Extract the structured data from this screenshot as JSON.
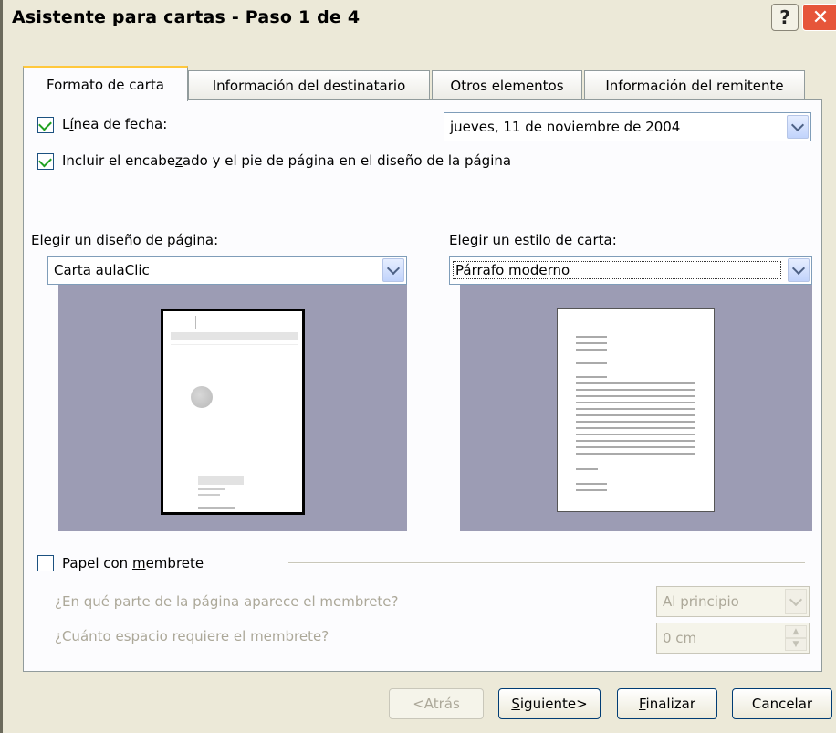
{
  "window": {
    "title": "Asistente para cartas - Paso 1 de 4"
  },
  "tabs": [
    {
      "label": "Formato de carta"
    },
    {
      "label": "Información del destinatario"
    },
    {
      "label": "Otros elementos"
    },
    {
      "label": "Información del remitente"
    }
  ],
  "date_line": {
    "label_pre": "L",
    "label_u": "í",
    "label_post": "nea de fecha:",
    "checked": true,
    "value": "jueves, 11 de noviembre de 2004"
  },
  "header_footer": {
    "label_pre": "Incluir el encabe",
    "label_u": "z",
    "label_post": "ado y el pie de página en el diseño de la página",
    "checked": true
  },
  "page_design": {
    "label_pre": "Elegir un ",
    "label_u": "d",
    "label_post": "iseño de página:",
    "value": "Carta aulaClic"
  },
  "letter_style": {
    "label_pre": "Ele",
    "label_u": "g",
    "label_post": "ir un estilo de carta:",
    "value": "Párrafo moderno"
  },
  "letterhead": {
    "label_pre": "Papel con ",
    "label_u": "m",
    "label_post": "embrete",
    "checked": false,
    "position_question": "¿En qué parte de la página aparece el membrete?",
    "position_value": "Al principio",
    "space_question": "¿Cuánto espacio requiere el membrete?",
    "space_value": "0 cm"
  },
  "buttons": {
    "back": "<Atrás",
    "next_u": "S",
    "next_rest": "iguiente>",
    "finish_u": "F",
    "finish_rest": "inalizar",
    "cancel": "Cancelar"
  },
  "icons": [
    "help-icon",
    "close-icon",
    "checkbox-checked-icon",
    "chevron-down-icon",
    "globe-icon",
    "spin-up-icon",
    "spin-down-icon"
  ]
}
